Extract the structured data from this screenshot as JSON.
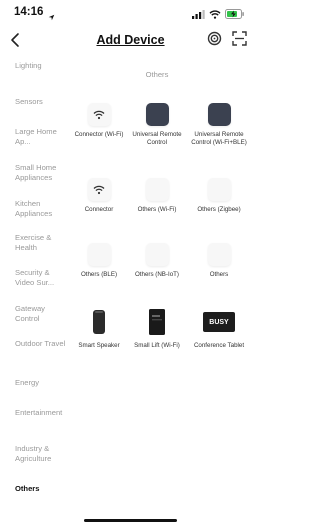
{
  "status": {
    "time": "14:16"
  },
  "nav": {
    "title": "Add Device"
  },
  "sidebar": {
    "items": [
      {
        "label": "Lighting"
      },
      {
        "label": "Sensors"
      },
      {
        "label": "Large Home Ap..."
      },
      {
        "label": "Small Home Appliances"
      },
      {
        "label": "Kitchen Appliances"
      },
      {
        "label": "Exercise & Health"
      },
      {
        "label": "Security & Video Sur..."
      },
      {
        "label": "Gateway Control"
      },
      {
        "label": "Outdoor Travel"
      },
      {
        "label": "Energy"
      },
      {
        "label": "Entertainment"
      },
      {
        "label": "Industry & Agriculture"
      },
      {
        "label": "Others"
      }
    ]
  },
  "main": {
    "section_title": "Others",
    "devices": [
      {
        "label": "Connector (Wi-Fi)",
        "icon": "wifi-connector-icon"
      },
      {
        "label": "Universal Remote Control",
        "icon": "remote-control-icon"
      },
      {
        "label": "Universal Remote Control (Wi-Fi+BLE)",
        "icon": "remote-control-icon"
      },
      {
        "label": "Connector",
        "icon": "wifi-connector-icon"
      },
      {
        "label": "Others (Wi-Fi)",
        "icon": "generic-device-icon"
      },
      {
        "label": "Others (Zigbee)",
        "icon": "generic-device-icon"
      },
      {
        "label": "Others (BLE)",
        "icon": "generic-device-icon"
      },
      {
        "label": "Others (NB-IoT)",
        "icon": "generic-device-icon"
      },
      {
        "label": "Others",
        "icon": "generic-device-icon"
      },
      {
        "label": "Smart Speaker",
        "icon": "smart-speaker-icon"
      },
      {
        "label": "Small Lift (Wi-Fi)",
        "icon": "small-lift-icon"
      },
      {
        "label": "Conference Tablet",
        "icon": "conference-tablet-icon",
        "badge": "BUSY"
      }
    ]
  }
}
